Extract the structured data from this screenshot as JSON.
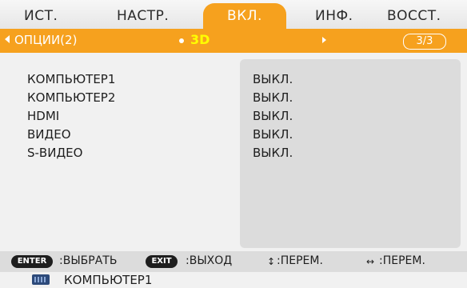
{
  "tabs": [
    {
      "label": "ИСТ.",
      "active": false
    },
    {
      "label": "НАСТР.",
      "active": false
    },
    {
      "label": "ВКЛ.",
      "active": true
    },
    {
      "label": "ИНФ.",
      "active": false
    },
    {
      "label": "ВОССТ.",
      "active": false
    }
  ],
  "subbar": {
    "options_label": "ОПЦИИ(2)",
    "current_label": "3D",
    "page_indicator": "3/3"
  },
  "rows": [
    {
      "name": "КОМПЬЮТЕР1",
      "value": "ВЫКЛ."
    },
    {
      "name": "КОМПЬЮТЕР2",
      "value": "ВЫКЛ."
    },
    {
      "name": "HDMI",
      "value": "ВЫКЛ."
    },
    {
      "name": "ВИДЕО",
      "value": "ВЫКЛ."
    },
    {
      "name": "S-ВИДЕО",
      "value": "ВЫКЛ."
    }
  ],
  "legend": {
    "enter_key": "ENTER",
    "enter_action": ":ВЫБРАТЬ",
    "exit_key": "EXIT",
    "exit_action": ":ВЫХОД",
    "updown_icon": "↕",
    "updown_action": ":ПЕРЕМ.",
    "leftright_icon": "↔",
    "leftright_action": ":ПЕРЕМ."
  },
  "status": {
    "source_label": "КОМПЬЮТЕР1",
    "source_icon": "monitor-icon"
  },
  "colors": {
    "accent": "#f6a11e",
    "highlight_text": "#ffff00",
    "panel": "#dcdcdc"
  }
}
